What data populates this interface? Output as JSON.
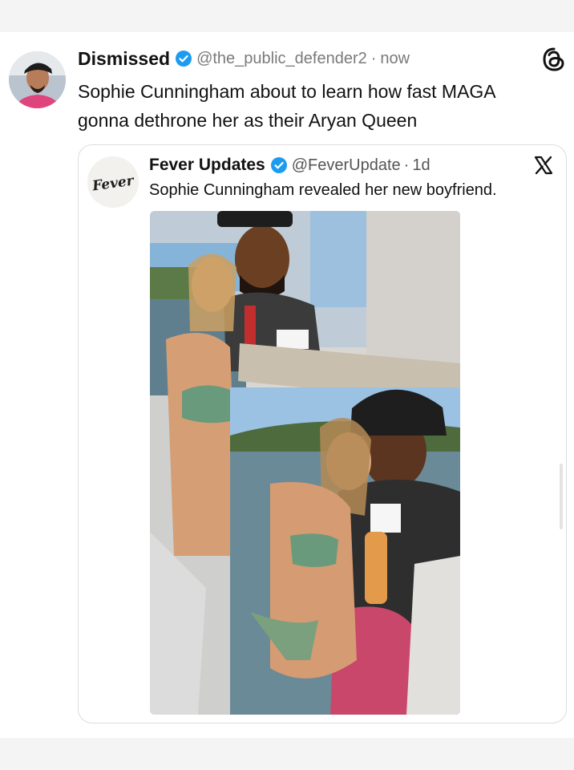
{
  "post": {
    "author_name": "Dismissed",
    "handle": "@the_public_defender2",
    "separator": "·",
    "time": "now",
    "text": "Sophie Cunningham about to learn how fast MAGA gonna dethrone her as their Aryan Queen",
    "platform_icon": "threads-icon"
  },
  "quote": {
    "author_name": "Fever Updates",
    "avatar_text": "Fever",
    "handle": "@FeverUpdate",
    "separator": "·",
    "time": "1d",
    "text": "Sophie Cunningham revealed her new boyfriend.",
    "platform_icon": "x-icon"
  },
  "colors": {
    "verified_blue": "#1d9bf0",
    "text": "#111111",
    "muted": "#7a7a7a",
    "border": "#dcdcdc"
  }
}
